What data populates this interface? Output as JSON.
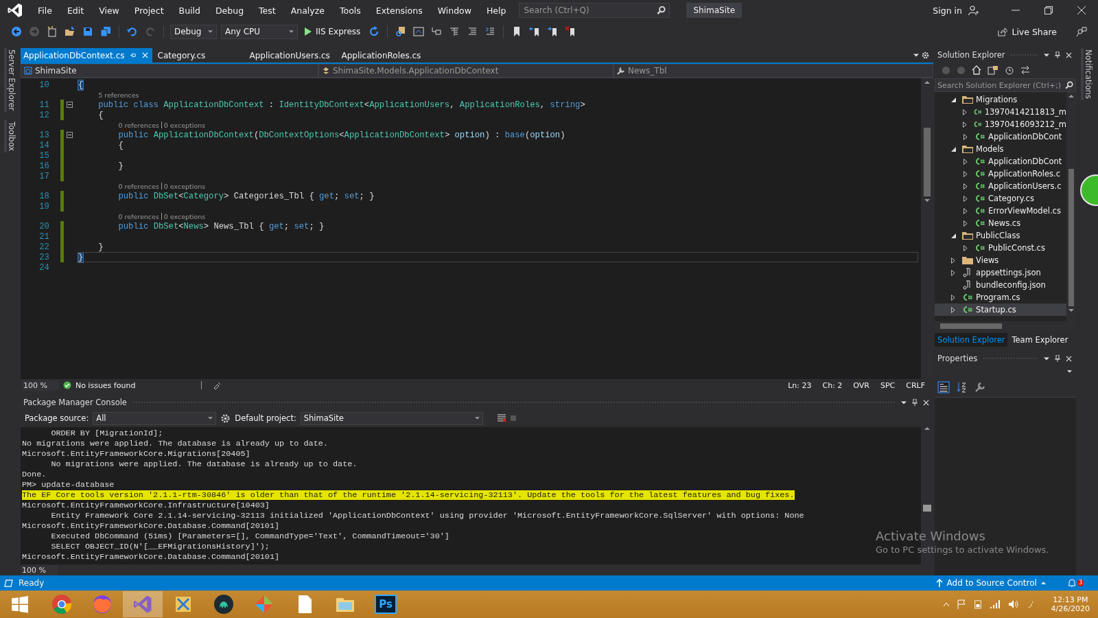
{
  "menu": [
    "File",
    "Edit",
    "View",
    "Project",
    "Build",
    "Debug",
    "Test",
    "Analyze",
    "Tools",
    "Extensions",
    "Window",
    "Help"
  ],
  "search": {
    "placeholder": "Search (Ctrl+Q)"
  },
  "solution_name": "ShimaSite",
  "account": {
    "label": "Sign in"
  },
  "toolbar": {
    "configuration": "Debug",
    "platform": "Any CPU",
    "run_target": "IIS Express",
    "live_share": "Live Share"
  },
  "left_tool_tabs": [
    "Server Explorer",
    "Toolbox"
  ],
  "right_tool_tabs": [
    "Notifications"
  ],
  "editor_tabs": [
    {
      "label": "ApplicationDbContext.cs",
      "selected": true
    },
    {
      "label": "Category.cs",
      "selected": false
    },
    {
      "label": "ApplicationUsers.cs",
      "selected": false
    },
    {
      "label": "ApplicationRoles.cs",
      "selected": false
    }
  ],
  "nav_bar": {
    "project": "ShimaSite",
    "type": "ShimaSite.Models.ApplicationDbContext",
    "member": "News_Tbl"
  },
  "code_lines": [
    {
      "number": "10",
      "changed": false,
      "foldable": false,
      "current": false,
      "tokens": [
        {
          "kind": "brace",
          "text": "{"
        }
      ]
    },
    {
      "number": "11",
      "changed": true,
      "foldable": true,
      "current": false,
      "lens": [
        "5 references"
      ],
      "tokens": [
        {
          "kind": "kw",
          "text": "    public class "
        },
        {
          "kind": "type",
          "text": "ApplicationDbContext"
        },
        {
          "kind": "plain",
          "text": " : "
        },
        {
          "kind": "type",
          "text": "IdentityDbContext"
        },
        {
          "kind": "plain",
          "text": "<"
        },
        {
          "kind": "type",
          "text": "ApplicationUsers"
        },
        {
          "kind": "plain",
          "text": ", "
        },
        {
          "kind": "type",
          "text": "ApplicationRoles"
        },
        {
          "kind": "plain",
          "text": ", "
        },
        {
          "kind": "kw",
          "text": "string"
        },
        {
          "kind": "plain",
          "text": ">"
        }
      ]
    },
    {
      "number": "12",
      "changed": true,
      "foldable": false,
      "current": false,
      "tokens": [
        {
          "kind": "plain",
          "text": "    {"
        }
      ]
    },
    {
      "number": "13",
      "changed": true,
      "foldable": true,
      "current": false,
      "lens": [
        "0 references",
        "0 exceptions"
      ],
      "tokens": [
        {
          "kind": "kw",
          "text": "        public "
        },
        {
          "kind": "type",
          "text": "ApplicationDbContext"
        },
        {
          "kind": "plain",
          "text": "("
        },
        {
          "kind": "type",
          "text": "DbContextOptions"
        },
        {
          "kind": "plain",
          "text": "<"
        },
        {
          "kind": "type",
          "text": "ApplicationDbContext"
        },
        {
          "kind": "plain",
          "text": "> "
        },
        {
          "kind": "param",
          "text": "option"
        },
        {
          "kind": "plain",
          "text": ") : "
        },
        {
          "kind": "kw",
          "text": "base"
        },
        {
          "kind": "plain",
          "text": "("
        },
        {
          "kind": "param",
          "text": "option"
        },
        {
          "kind": "plain",
          "text": ")"
        }
      ]
    },
    {
      "number": "14",
      "changed": true,
      "foldable": false,
      "current": false,
      "tokens": [
        {
          "kind": "plain",
          "text": "        {"
        }
      ]
    },
    {
      "number": "15",
      "changed": true,
      "foldable": false,
      "current": false
    },
    {
      "number": "16",
      "changed": true,
      "foldable": false,
      "current": false,
      "tokens": [
        {
          "kind": "plain",
          "text": "        }"
        }
      ]
    },
    {
      "number": "17",
      "changed": true,
      "foldable": false,
      "current": false
    },
    {
      "number": "18",
      "changed": true,
      "foldable": false,
      "current": false,
      "lens": [
        "0 references",
        "0 exceptions"
      ],
      "tokens": [
        {
          "kind": "kw",
          "text": "        public "
        },
        {
          "kind": "type",
          "text": "DbSet"
        },
        {
          "kind": "plain",
          "text": "<"
        },
        {
          "kind": "type",
          "text": "Category"
        },
        {
          "kind": "plain",
          "text": "> Categories_Tbl { "
        },
        {
          "kind": "kw",
          "text": "get"
        },
        {
          "kind": "plain",
          "text": "; "
        },
        {
          "kind": "kw",
          "text": "set"
        },
        {
          "kind": "plain",
          "text": "; }"
        }
      ]
    },
    {
      "number": "19",
      "changed": true,
      "foldable": false,
      "current": false
    },
    {
      "number": "20",
      "changed": true,
      "foldable": false,
      "current": false,
      "lens": [
        "0 references",
        "0 exceptions"
      ],
      "tokens": [
        {
          "kind": "kw",
          "text": "        public "
        },
        {
          "kind": "type",
          "text": "DbSet"
        },
        {
          "kind": "plain",
          "text": "<"
        },
        {
          "kind": "type",
          "text": "News"
        },
        {
          "kind": "plain",
          "text": "> News_Tbl { "
        },
        {
          "kind": "kw",
          "text": "get"
        },
        {
          "kind": "plain",
          "text": "; "
        },
        {
          "kind": "kw",
          "text": "set"
        },
        {
          "kind": "plain",
          "text": "; }"
        }
      ]
    },
    {
      "number": "21",
      "changed": true,
      "foldable": false,
      "current": false
    },
    {
      "number": "22",
      "changed": true,
      "foldable": false,
      "current": false,
      "tokens": [
        {
          "kind": "plain",
          "text": "    }"
        }
      ]
    },
    {
      "number": "23",
      "changed": true,
      "foldable": false,
      "current": true,
      "tokens": [
        {
          "kind": "brace",
          "text": "}"
        }
      ]
    },
    {
      "number": "24",
      "changed": false,
      "foldable": false,
      "current": false
    }
  ],
  "editor_status": {
    "zoom": "100 %",
    "issues": "No issues found",
    "line": "Ln: 23",
    "column": "Ch: 2",
    "mode": "OVR",
    "indent": "SPC",
    "line_ending": "CRLF"
  },
  "console": {
    "title": "Package Manager Console",
    "source_label": "Package source:",
    "source": "All",
    "project_label": "Default project:",
    "project": "ShimaSite",
    "zoom": "100 %",
    "lines": [
      {
        "kind": "normal",
        "text": "      ORDER BY [MigrationId];"
      },
      {
        "kind": "normal",
        "text": "No migrations were applied. The database is already up to date."
      },
      {
        "kind": "normal",
        "text": "Microsoft.EntityFrameworkCore.Migrations[20405]"
      },
      {
        "kind": "normal",
        "text": "      No migrations were applied. The database is already up to date."
      },
      {
        "kind": "normal",
        "text": "Done."
      },
      {
        "kind": "normal",
        "text": "PM> update-database"
      },
      {
        "kind": "warning",
        "text": "The EF Core tools version '2.1.1-rtm-30846' is older than that of the runtime '2.1.14-servicing-32113'. Update the tools for the latest features and bug fixes."
      },
      {
        "kind": "normal",
        "text": "Microsoft.EntityFrameworkCore.Infrastructure[10403]"
      },
      {
        "kind": "normal",
        "text": "      Entity Framework Core 2.1.14-servicing-32113 initialized 'ApplicationDbContext' using provider 'Microsoft.EntityFrameworkCore.SqlServer' with options: None"
      },
      {
        "kind": "normal",
        "text": "Microsoft.EntityFrameworkCore.Database.Command[20101]"
      },
      {
        "kind": "normal",
        "text": "      Executed DbCommand (51ms) [Parameters=[], CommandType='Text', CommandTimeout='30']"
      },
      {
        "kind": "normal",
        "text": "      SELECT OBJECT_ID(N'[__EFMigrationsHistory]');"
      },
      {
        "kind": "normal",
        "text": "Microsoft.EntityFrameworkCore.Database.Command[20101]"
      }
    ]
  },
  "solution_explorer": {
    "title": "Solution Explorer",
    "search": {
      "placeholder": "Search Solution Explorer (Ctrl+;)"
    },
    "tree": [
      {
        "label": "Migrations",
        "kind": "folder",
        "expanded": true,
        "selected": false,
        "children": [
          {
            "label": "13970414211813_m",
            "kind": "csharp",
            "expanded": false,
            "selected": false
          },
          {
            "label": "13970416093212_m",
            "kind": "csharp",
            "expanded": false,
            "selected": false
          },
          {
            "label": "ApplicationDbCont",
            "kind": "csharp",
            "expanded": false,
            "selected": false
          }
        ]
      },
      {
        "label": "Models",
        "kind": "folder",
        "expanded": true,
        "selected": false,
        "children": [
          {
            "label": "ApplicationDbCont",
            "kind": "csharp",
            "expanded": false,
            "selected": false
          },
          {
            "label": "ApplicationRoles.c",
            "kind": "csharp",
            "expanded": false,
            "selected": false
          },
          {
            "label": "ApplicationUsers.c",
            "kind": "csharp",
            "expanded": false,
            "selected": false
          },
          {
            "label": "Category.cs",
            "kind": "csharp",
            "expanded": false,
            "selected": false
          },
          {
            "label": "ErrorViewModel.cs",
            "kind": "csharp",
            "expanded": false,
            "selected": false
          },
          {
            "label": "News.cs",
            "kind": "csharp",
            "expanded": false,
            "selected": false
          }
        ]
      },
      {
        "label": "PublicClass",
        "kind": "folder",
        "expanded": true,
        "selected": false,
        "children": [
          {
            "label": "PublicConst.cs",
            "kind": "csharp",
            "expanded": false,
            "selected": false
          }
        ]
      },
      {
        "label": "Views",
        "kind": "folder",
        "expanded": false,
        "selected": false
      },
      {
        "label": "appsettings.json",
        "kind": "json",
        "expanded": false,
        "selected": false
      },
      {
        "label": "bundleconfig.json",
        "kind": "json",
        "selected": false
      },
      {
        "label": "Program.cs",
        "kind": "csharp",
        "expanded": false,
        "selected": false
      },
      {
        "label": "Startup.cs",
        "kind": "csharp",
        "expanded": false,
        "selected": true
      }
    ]
  },
  "panel_tabs": [
    {
      "label": "Solution Explorer",
      "selected": true
    },
    {
      "label": "Team Explorer",
      "selected": false
    }
  ],
  "properties": {
    "title": "Properties"
  },
  "activation": {
    "title": "Activate Windows",
    "subtitle": "Go to PC settings to activate Windows."
  },
  "status_bar": {
    "state": "Ready",
    "source_control": "Add to Source Control",
    "notifications": "3"
  },
  "taskbar": {
    "time": "12:13 PM",
    "date": "4/26/2020",
    "apps": [
      {
        "kind": "browser",
        "selected": false
      },
      {
        "kind": "fox",
        "selected": false
      },
      {
        "kind": "studio",
        "selected": true
      },
      {
        "kind": "tools",
        "selected": false
      },
      {
        "kind": "octo",
        "selected": false
      },
      {
        "kind": "git",
        "selected": false
      },
      {
        "kind": "file",
        "selected": false
      },
      {
        "kind": "explorer",
        "selected": false
      },
      {
        "kind": "photoshop",
        "label": "Ps",
        "selected": false
      }
    ]
  }
}
